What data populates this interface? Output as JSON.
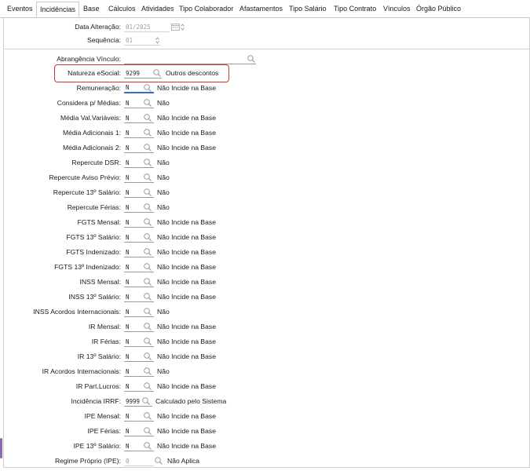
{
  "tabs": [
    {
      "label": "Eventos",
      "active": false
    },
    {
      "label": "Incidências",
      "active": true
    },
    {
      "label": "Base",
      "active": false
    },
    {
      "label": "Cálculos",
      "active": false
    },
    {
      "label": "Atividades",
      "active": false
    },
    {
      "label": "Tipo Colaborador",
      "active": false
    },
    {
      "label": "Afastamentos",
      "active": false
    },
    {
      "label": "Tipo Salário",
      "active": false
    },
    {
      "label": "Tipo Contrato",
      "active": false
    },
    {
      "label": "Vínculos",
      "active": false
    },
    {
      "label": "Órgão Público",
      "active": false
    }
  ],
  "header": {
    "data_alteracao": {
      "label": "Data Alteração:",
      "value": "01/2025"
    },
    "sequencia": {
      "label": "Sequência:",
      "value": "01"
    }
  },
  "abrangencia": {
    "label": "Abrangência Vínculo:",
    "value": ""
  },
  "natureza": {
    "label": "Natureza eSocial:",
    "value": "9299",
    "description": "Outros descontos"
  },
  "rows": [
    {
      "label": "Remuneração:",
      "value": "N",
      "description": "Não Incide na Base"
    },
    {
      "label": "Considera p/ Médias:",
      "value": "N",
      "description": "Não"
    },
    {
      "label": "Média Val.Variáveis:",
      "value": "N",
      "description": "Não Incide na Base"
    },
    {
      "label": "Média Adicionais 1:",
      "value": "N",
      "description": "Não Incide na Base"
    },
    {
      "label": "Média Adicionais 2:",
      "value": "N",
      "description": "Não Incide na Base"
    },
    {
      "label": "Repercute DSR:",
      "value": "N",
      "description": "Não"
    },
    {
      "label": "Repercute Aviso Prévio:",
      "value": "N",
      "description": "Não"
    },
    {
      "label": "Repercute 13º Salário:",
      "value": "N",
      "description": "Não"
    },
    {
      "label": "Repercute Férias:",
      "value": "N",
      "description": "Não"
    },
    {
      "label": "FGTS Mensal:",
      "value": "N",
      "description": "Não Incide na Base"
    },
    {
      "label": "FGTS 13º Salário:",
      "value": "N",
      "description": "Não Incide na Base"
    },
    {
      "label": "FGTS Indenizado:",
      "value": "N",
      "description": "Não Incide na Base"
    },
    {
      "label": "FGTS 13º Indenizado:",
      "value": "N",
      "description": "Não Incide na Base"
    },
    {
      "label": "INSS Mensal:",
      "value": "N",
      "description": "Não Incide na Base"
    },
    {
      "label": "INSS 13º Salário:",
      "value": "N",
      "description": "Não Incide na Base"
    },
    {
      "label": "INSS Acordos Internacionais:",
      "value": "N",
      "description": "Não"
    },
    {
      "label": "IR Mensal:",
      "value": "N",
      "description": "Não Incide na Base"
    },
    {
      "label": "IR Férias:",
      "value": "N",
      "description": "Não Incide na Base"
    },
    {
      "label": "IR 13º Salário:",
      "value": "N",
      "description": "Não Incide na Base"
    },
    {
      "label": "IR Acordos Internacionais:",
      "value": "N",
      "description": "Não"
    },
    {
      "label": "IR Part.Lucros:",
      "value": "N",
      "description": "Não Incide na Base"
    },
    {
      "label": "Incidência IRRF:",
      "value": "9999",
      "description": "Calculado pelo Sistema"
    },
    {
      "label": "IPE Mensal:",
      "value": "N",
      "description": "Não Incide na Base"
    },
    {
      "label": "IPE Férias:",
      "value": "N",
      "description": "Não Incide na Base"
    },
    {
      "label": "IPE 13º Salário:",
      "value": "N",
      "description": "Não Incide na Base"
    },
    {
      "label": "Regime Próprio (IPE):",
      "value": "0",
      "description": "Não Aplica"
    }
  ],
  "colors": {
    "highlight_border": "#d9342b",
    "focus_underline": "#2c6fd1",
    "accent": "#8a6aa8"
  }
}
